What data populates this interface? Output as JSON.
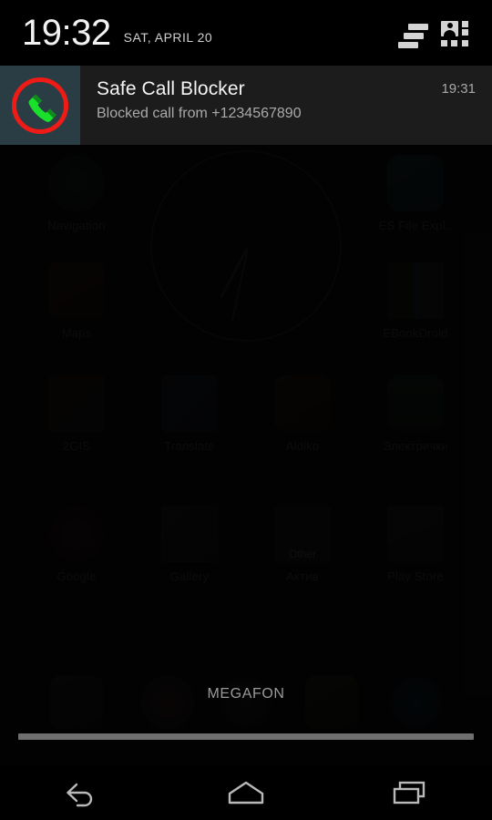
{
  "status_bar": {
    "time": "19:32",
    "date": "SAT, APRIL 20",
    "clear_all_icon": "clear-all-notifications-icon",
    "quick_settings_icon": "quick-settings-user-icon"
  },
  "notifications": [
    {
      "app_title": "Safe Call Blocker",
      "message": "Blocked call from +1234567890",
      "time": "19:31",
      "icon": "blocked-call-icon",
      "icon_tile_color": "#2a3c44",
      "icon_ring_color": "#ef1b16",
      "icon_phone_color": "#19e02a"
    }
  ],
  "home_screen": {
    "clock_widget": "analog-clock-widget",
    "rows": [
      [
        {
          "label": "Navigation",
          "icon": "navigation-app-icon"
        },
        {
          "label": "",
          "icon": ""
        },
        {
          "label": "",
          "icon": ""
        },
        {
          "label": "ES File Expl..",
          "icon": "es-file-explorer-app-icon"
        }
      ],
      [
        {
          "label": "Maps",
          "icon": "maps-app-icon"
        },
        {
          "label": "",
          "icon": ""
        },
        {
          "label": "",
          "icon": ""
        },
        {
          "label": "EBookDroid",
          "icon": "ebookdroid-app-icon"
        }
      ],
      [
        {
          "label": "2GIS",
          "icon": "2gis-app-icon"
        },
        {
          "label": "Translate",
          "icon": "translate-app-icon"
        },
        {
          "label": "Aldiko",
          "icon": "aldiko-app-icon"
        },
        {
          "label": "Электрички",
          "icon": "elektrichki-app-icon"
        }
      ],
      [
        {
          "label": "Google",
          "icon": "google-folder-icon"
        },
        {
          "label": "Gallery",
          "icon": "gallery-app-icon"
        },
        {
          "label": "Актив",
          "icon": "aktiv-folder-icon"
        },
        {
          "label": "Play Store",
          "icon": "play-store-app-icon"
        }
      ]
    ],
    "folder_caption": "Other",
    "carrier": "MEGAFON",
    "dock": [
      {
        "icon": "camera-app-icon"
      },
      {
        "icon": "chrome-app-icon"
      },
      {
        "icon": "app-drawer-icon"
      },
      {
        "icon": "messaging-app-icon"
      },
      {
        "icon": "phone-app-icon"
      }
    ]
  },
  "nav_bar": {
    "back": "back-icon",
    "home": "home-icon",
    "recents": "recents-icon"
  },
  "colors": {
    "shade_background": "#1c1c1c",
    "header_background": "#000000",
    "accent_red": "#ef1b16",
    "accent_green": "#19e02a"
  }
}
